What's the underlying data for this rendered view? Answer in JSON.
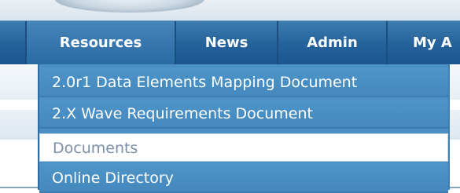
{
  "nav": {
    "items": [
      {
        "label": "Resources"
      },
      {
        "label": "News"
      },
      {
        "label": "Admin"
      },
      {
        "label": "My A"
      }
    ]
  },
  "dropdown": {
    "items": [
      {
        "label": "2.0r1 Data Elements Mapping Document"
      },
      {
        "label": "2.X Wave Requirements Document"
      },
      {
        "label": "Documents",
        "hovered": true
      },
      {
        "label": "Online Directory"
      }
    ]
  },
  "colors": {
    "nav_background": "#24619a",
    "dropdown_background": "#4a90c4",
    "hover_background": "#ffffff",
    "hover_text": "#7d8fa8"
  }
}
